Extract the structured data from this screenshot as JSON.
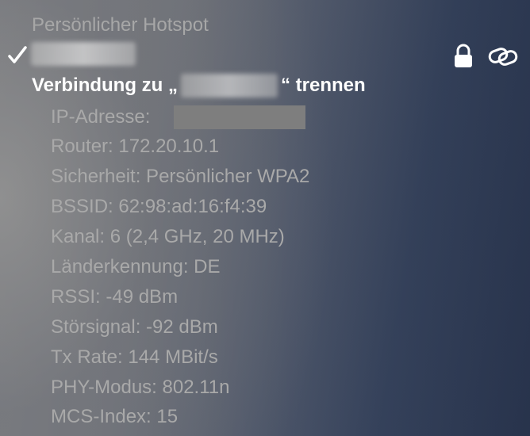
{
  "section_header": "Persönlicher Hotspot",
  "network": {
    "name_redacted": true,
    "icons": [
      "checkmark-icon",
      "lock-icon",
      "personal-hotspot-link-icon"
    ]
  },
  "disconnect": {
    "prefix": "Verbindung zu „",
    "suffix": "“ trennen"
  },
  "details": {
    "ip_label": "IP-Adresse:",
    "router": "Router: 172.20.10.1",
    "security": "Sicherheit: Persönlicher WPA2",
    "bssid": "BSSID: 62:98:ad:16:f4:39",
    "channel": "Kanal: 6 (2,4 GHz, 20 MHz)",
    "country": "Länderkennung: DE",
    "rssi": "RSSI: -49 dBm",
    "noise": "Störsignal: -92 dBm",
    "tx_rate": "Tx Rate: 144 MBit/s",
    "phy_mode": "PHY-Modus: 802.11n",
    "mcs_index": "MCS-Index: 15"
  },
  "colors": {
    "header_text": "#a7a7a7",
    "detail_text": "#a9a9a9",
    "action_text": "#ffffff"
  }
}
